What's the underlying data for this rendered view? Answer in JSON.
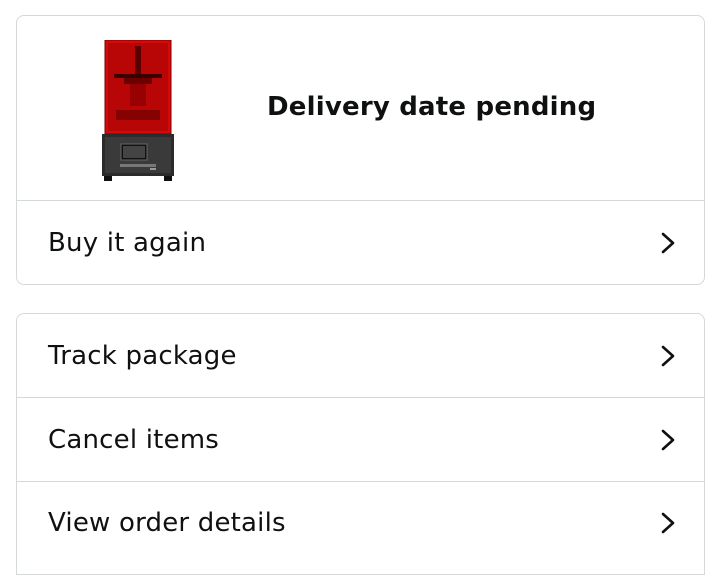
{
  "order": {
    "status_text": "Delivery date pending",
    "product_image": "resin-3d-printer-thumbnail",
    "buy_again_label": "Buy it again"
  },
  "actions": [
    {
      "label": "Track package",
      "icon": "chevron-right-icon"
    },
    {
      "label": "Cancel items",
      "icon": "chevron-right-icon"
    },
    {
      "label": "View order details",
      "icon": "chevron-right-icon"
    }
  ],
  "colors": {
    "border": "#d5d9d9",
    "text": "#0f1111",
    "printer_red": "#d40a0a",
    "printer_body": "#2b2b2b"
  }
}
